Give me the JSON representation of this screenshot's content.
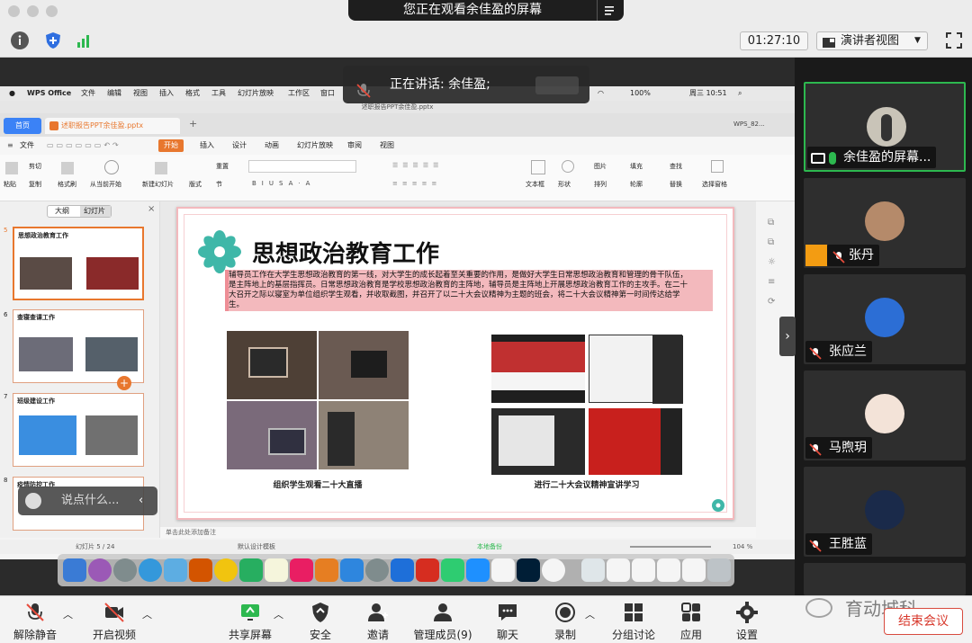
{
  "banner": {
    "text": "您正在观看余佳盈的屏幕"
  },
  "toolbar": {
    "timer": "01:27:10",
    "view_mode": "演讲者视图"
  },
  "speaking": {
    "label": "正在讲话: 余佳盈;"
  },
  "mac": {
    "menu": [
      "WPS Office",
      "文件",
      "编辑",
      "视图",
      "插入",
      "格式",
      "工具",
      "幻灯片放映",
      "工作区",
      "窗口"
    ],
    "battery": "100%",
    "clock": "周三 10:51"
  },
  "wps": {
    "window_title": "述职报告PPT余佳盈.pptx",
    "tab_home": "首页",
    "tab_file": "述职报告PPT余佳盈.pptx",
    "tab_right": "WPS_82...",
    "menu": [
      "文件",
      "开始",
      "插入",
      "设计",
      "动画",
      "幻灯片放映",
      "审阅",
      "视图"
    ],
    "ribbon": [
      "粘贴",
      "剪切",
      "复制",
      "格式刷",
      "从当前开始",
      "新建幻灯片",
      "版式",
      "重置",
      "节",
      "文本框",
      "形状",
      "图片",
      "排列",
      "填充",
      "轮廓",
      "查找",
      "替换",
      "选择窗格"
    ],
    "panel_tabs": [
      "大纲",
      "幻灯片"
    ],
    "thumbs": [
      {
        "num": "5",
        "title": "思想政治教育工作"
      },
      {
        "num": "6",
        "title": "查寝查课工作"
      },
      {
        "num": "7",
        "title": "班级建设工作"
      },
      {
        "num": "8",
        "title": "疫情防控工作"
      }
    ],
    "chat_placeholder": "说点什么...",
    "status_slide": "幻灯片 5 / 24",
    "status_theme": "默认设计模板",
    "status_backup": "本地备份",
    "status_zoom": "104 %",
    "notes_hint": "单击此处添加备注"
  },
  "slide": {
    "title": "思想政治教育工作",
    "body": "辅导员工作在大学生思想政治教育的第一线，对大学生的成长起着至关重要的作用，是做好大学生日常思想政治教育和管理的骨干队伍，是主阵地上的基层指挥员。日常思想政治教育是学校思想政治教育的主阵地，辅导员是主阵地上开展思想政治教育工作的主攻手。在二十大召开之际以寝室为单位组织学生观看，并收取截图，并召开了以二十大会议精神为主题的班会，将二十大会议精神第一时间传达给学生。",
    "caption_left": "组织学生观看二十大直播",
    "caption_right": "进行二十大会议精神宣讲学习"
  },
  "participants": [
    {
      "name": "余佳盈的屏幕...",
      "active": true
    },
    {
      "name": "张丹",
      "active": false
    },
    {
      "name": "张应兰",
      "active": false
    },
    {
      "name": "马煦玥",
      "active": false
    },
    {
      "name": "王胜蓝",
      "active": false
    }
  ],
  "bottom": {
    "unmute": "解除静音",
    "video": "开启视频",
    "share": "共享屏幕",
    "security": "安全",
    "invite": "邀请",
    "members": "管理成员(9)",
    "chat": "聊天",
    "record": "录制",
    "breakout": "分组讨论",
    "apps": "应用",
    "settings": "设置",
    "end": "结束会议"
  },
  "watermark": "育动城科",
  "colors": {
    "accent_green": "#2db84f",
    "end_red": "#d83a2e",
    "slide_pink": "#f3b9bd",
    "wps_orange": "#e8772e"
  }
}
